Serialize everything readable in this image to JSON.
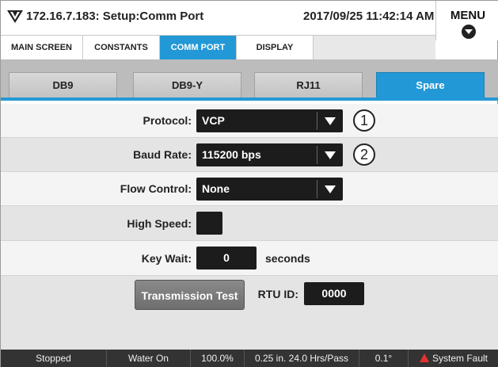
{
  "header": {
    "title": "172.16.7.183: Setup:Comm Port",
    "datetime": "2017/09/25 11:42:14 AM",
    "menu_label": "MENU"
  },
  "main_tabs": [
    {
      "label": "MAIN SCREEN",
      "active": false
    },
    {
      "label": "CONSTANTS",
      "active": false
    },
    {
      "label": "COMM PORT",
      "active": true
    },
    {
      "label": "DISPLAY",
      "active": false
    }
  ],
  "port_tabs": [
    {
      "label": "DB9",
      "active": false
    },
    {
      "label": "DB9-Y",
      "active": false
    },
    {
      "label": "RJ11",
      "active": false
    },
    {
      "label": "Spare",
      "active": true
    }
  ],
  "form": {
    "protocol": {
      "label": "Protocol:",
      "value": "VCP",
      "callout": "1"
    },
    "baud_rate": {
      "label": "Baud Rate:",
      "value": "115200 bps",
      "callout": "2"
    },
    "flow_control": {
      "label": "Flow Control:",
      "value": "None"
    },
    "high_speed": {
      "label": "High Speed:",
      "checked": false
    },
    "key_wait": {
      "label": "Key Wait:",
      "value": "0",
      "unit": "seconds"
    },
    "transmission_test": {
      "label": "Transmission Test"
    },
    "rtu_id": {
      "label": "RTU ID:",
      "value": "0000"
    }
  },
  "status": {
    "state": "Stopped",
    "water": "Water On",
    "percent": "100.0%",
    "depth_rate": "0.25 in.  24.0 Hrs/Pass",
    "angle": "0.1°",
    "fault": "System Fault"
  },
  "colors": {
    "accent": "#2299d6",
    "field_bg": "#1c1c1c",
    "status_bg": "#333333",
    "fault_icon": "#e53030"
  }
}
